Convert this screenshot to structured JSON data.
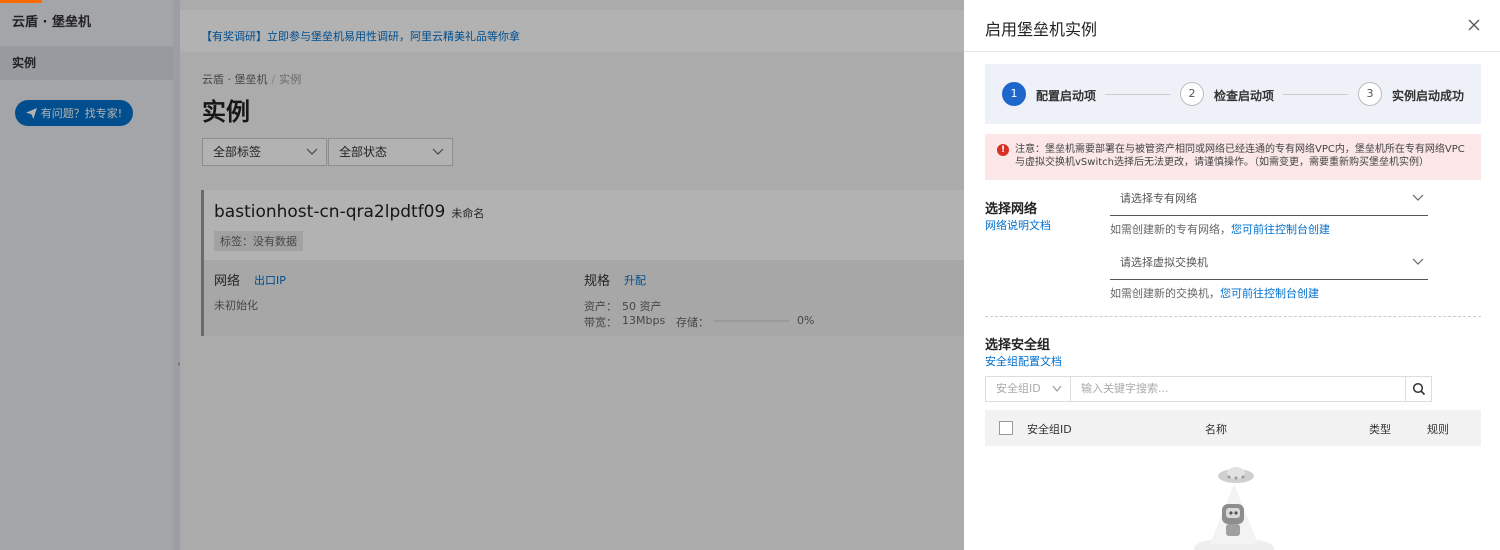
{
  "sidebar": {
    "title": "云盾 · 堡垒机",
    "items": [
      {
        "label": "实例"
      }
    ],
    "expert_button": "有问题？找专家!"
  },
  "main": {
    "notice": "【有奖调研】立即参与堡垒机易用性调研，阿里云精美礼品等你拿",
    "breadcrumb": {
      "root": "云盾 · 堡垒机",
      "sep": "/",
      "current": "实例"
    },
    "title": "实例",
    "filters": [
      {
        "label": "全部标签"
      },
      {
        "label": "全部状态"
      }
    ],
    "instance": {
      "name": "bastionhost-cn-qra2lpdtf09",
      "alias": "未命名",
      "tag": "标签：没有数据",
      "network_label": "网络",
      "network_link": "出口IP",
      "network_status": "未初始化",
      "spec_label": "规格",
      "spec_link": "升配",
      "assets_label": "资产：",
      "assets_value": "50 资产",
      "bandwidth_label": "带宽：",
      "bandwidth_value": "13Mbps",
      "storage_label": "存储：",
      "storage_value": "0%",
      "storage_fraction": 0
    }
  },
  "drawer": {
    "title": "启用堡垒机实例",
    "steps": [
      {
        "num": "1",
        "label": "配置启动项"
      },
      {
        "num": "2",
        "label": "检查启动项"
      },
      {
        "num": "3",
        "label": "实例启动成功"
      }
    ],
    "warning_icon": "!",
    "warning": "注意：堡垒机需要部署在与被管资产相同或网络已经连通的专有网络VPC内，堡垒机所在专有网络VPC与虚拟交换机vSwitch选择后无法更改，请谨慎操作。（如需变更，需要重新购买堡垒机实例）",
    "network": {
      "label": "选择网络",
      "doc_link": "网络说明文档",
      "vpc_placeholder": "请选择专有网络",
      "vpc_hint": "如需创建新的专有网络，",
      "vpc_hint_link": "您可前往控制台创建",
      "vswitch_placeholder": "请选择虚拟交换机",
      "vswitch_hint": "如需创建新的交换机，",
      "vswitch_hint_link": "您可前往控制台创建"
    },
    "security_group": {
      "label": "选择安全组",
      "doc_link": "安全组配置文档",
      "search_type": "安全组ID",
      "search_placeholder": "输入关键字搜索...",
      "columns": [
        "安全组ID",
        "名称",
        "类型",
        "规则"
      ]
    }
  }
}
